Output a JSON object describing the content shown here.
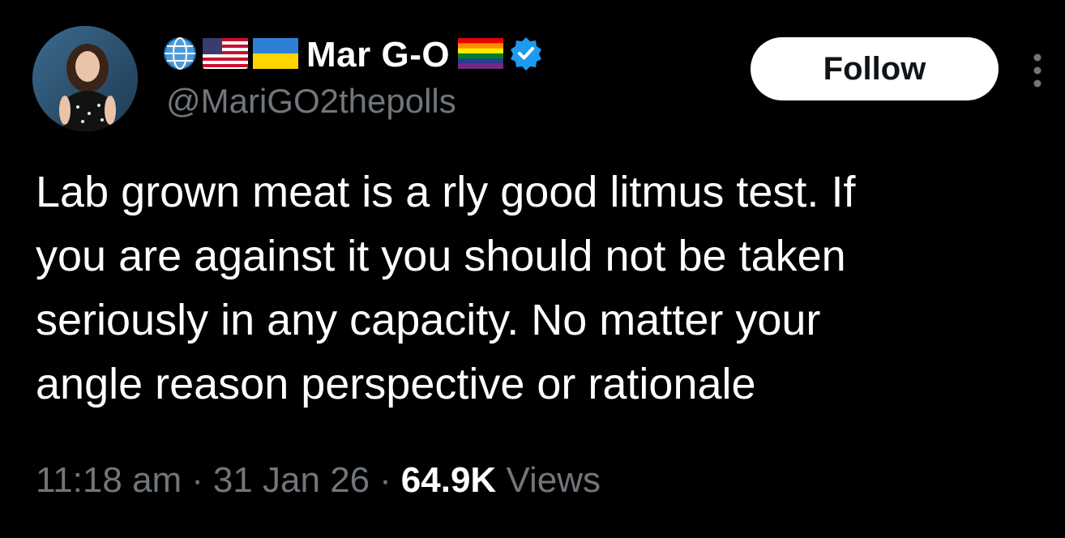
{
  "post": {
    "author": {
      "display_name": "Mar G-O",
      "handle": "@MariGO2thepolls",
      "name_prefix_icons": [
        "globe-icon",
        "us-flag-icon",
        "ukraine-flag-icon"
      ],
      "name_suffix_icons": [
        "rainbow-flag-icon",
        "verified-badge-icon"
      ]
    },
    "follow_label": "Follow",
    "more_icon": "more-vertical-icon",
    "text": "Lab grown meat is a rly good litmus test. If\nyou are against it you should not be taken\nseriously in any capacity. No matter your\nangle reason perspective or rationale",
    "meta": {
      "time": "11:18 am",
      "separator": "·",
      "date": "31 Jan 26",
      "views_count": "64.9K",
      "views_label": "Views"
    }
  },
  "colors": {
    "background": "#000000",
    "text_primary": "#ffffff",
    "text_secondary": "#71767b",
    "verified_blue": "#1d9bf0",
    "follow_button_bg": "#ffffff",
    "follow_button_text": "#0f1419"
  }
}
